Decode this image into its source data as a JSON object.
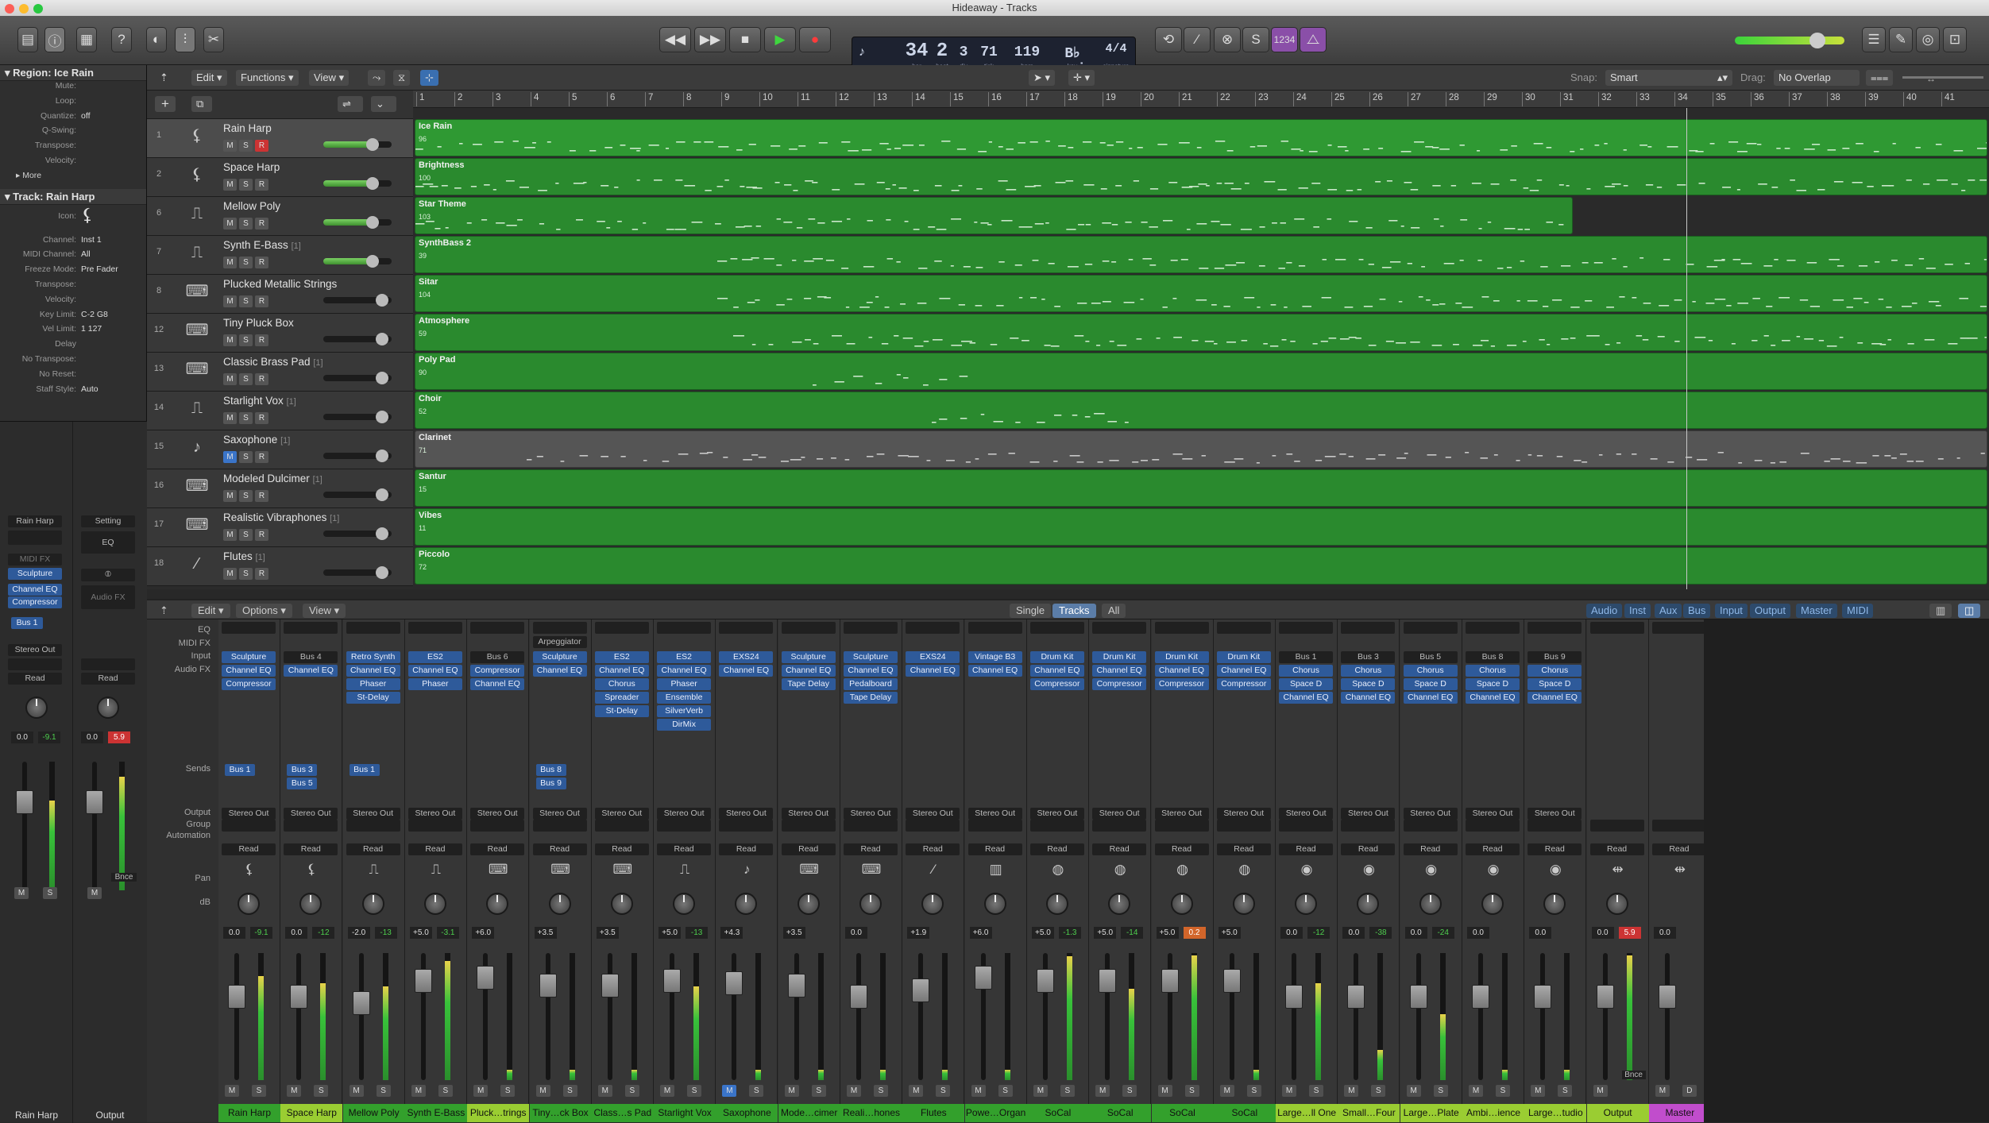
{
  "window": {
    "title": "Hideaway - Tracks"
  },
  "transport": {
    "bar": "34",
    "beat": "2",
    "div": "3",
    "tick": "71",
    "bpm": "119",
    "key": "B♭ maj",
    "sig": "4/4",
    "bar_l": "bar",
    "beat_l": "beat",
    "div_l": "div",
    "tick_l": "tick",
    "bpm_l": "bpm",
    "key_l": "key",
    "sig_l": "signature",
    "cycle_counter": "1234"
  },
  "inspector": {
    "region_title": "Region: Ice Rain",
    "region_rows": [
      [
        "Mute:",
        ""
      ],
      [
        "Loop:",
        ""
      ],
      [
        "Quantize:",
        "off"
      ],
      [
        "Q-Swing:",
        ""
      ],
      [
        "Transpose:",
        ""
      ],
      [
        "Velocity:",
        ""
      ]
    ],
    "more": "More",
    "track_title": "Track:  Rain Harp",
    "icon_label": "Icon:",
    "track_rows": [
      [
        "Channel:",
        "Inst 1"
      ],
      [
        "MIDI Channel:",
        "All"
      ],
      [
        "Freeze Mode:",
        "Pre Fader"
      ],
      [
        "Transpose:",
        ""
      ],
      [
        "Velocity:",
        ""
      ],
      [
        "Key Limit:",
        "C-2     G8"
      ],
      [
        "Vel Limit:",
        "1     127"
      ],
      [
        "Delay",
        ""
      ],
      [
        "No Transpose:",
        ""
      ],
      [
        "No Reset:",
        ""
      ],
      [
        "Staff Style:",
        "Auto"
      ]
    ],
    "strip1": {
      "input": "Rain Harp",
      "midi_fx": "MIDI FX",
      "instr": "Sculpture",
      "fx": [
        "Channel EQ",
        "Compressor"
      ],
      "send": "Bus 1",
      "output": "Stereo Out",
      "automation": "Read",
      "vol": "0.0",
      "peak": "-9.1",
      "name": "Rain Harp"
    },
    "strip2": {
      "setting": "Setting",
      "eq": "EQ",
      "audiofx": "Audio FX",
      "automation": "Read",
      "vol": "0.0",
      "peak": "5.9",
      "bnce": "Bnce",
      "name": "Output"
    }
  },
  "tracks_area": {
    "menus": [
      "Edit",
      "Functions",
      "View"
    ],
    "snap_label": "Snap:",
    "snap_value": "Smart",
    "drag_label": "Drag:",
    "drag_value": "No Overlap",
    "bars": [
      "1",
      "2",
      "3",
      "4",
      "5",
      "6",
      "7",
      "8",
      "9",
      "10",
      "11",
      "12",
      "13",
      "14",
      "15",
      "16",
      "17",
      "18",
      "19",
      "20",
      "21",
      "22",
      "23",
      "24",
      "25",
      "26",
      "27",
      "28",
      "29",
      "30",
      "31",
      "32",
      "33",
      "34",
      "35",
      "36",
      "37",
      "38",
      "39",
      "40",
      "41"
    ]
  },
  "tracks": [
    {
      "num": "1",
      "name": "Rain Harp",
      "sub": "",
      "icon": "harp-icon",
      "region": "Ice Rain",
      "val": "96"
    },
    {
      "num": "2",
      "name": "Space Harp",
      "sub": "",
      "icon": "harp-icon",
      "region": "Brightness",
      "val": "100"
    },
    {
      "num": "6",
      "name": "Mellow Poly",
      "sub": "",
      "icon": "synth-icon",
      "region": "Star Theme",
      "val": "103"
    },
    {
      "num": "7",
      "name": "Synth E-Bass",
      "sub": "[1]",
      "icon": "synth-icon",
      "region": "SynthBass 2",
      "val": "39"
    },
    {
      "num": "8",
      "name": "Plucked Metallic Strings",
      "sub": "",
      "icon": "keyboard-icon",
      "region": "Sitar",
      "val": "104"
    },
    {
      "num": "12",
      "name": "Tiny Pluck Box",
      "sub": "",
      "icon": "keyboard-icon",
      "region": "Atmosphere",
      "val": "59"
    },
    {
      "num": "13",
      "name": "Classic Brass Pad",
      "sub": "[1]",
      "icon": "keyboard-icon",
      "region": "Poly Pad",
      "val": "90"
    },
    {
      "num": "14",
      "name": "Starlight Vox",
      "sub": "[1]",
      "icon": "synth-icon",
      "region": "Choir",
      "val": "52"
    },
    {
      "num": "15",
      "name": "Saxophone",
      "sub": "[1]",
      "icon": "saxophone-icon",
      "region": "Clarinet",
      "val": "71"
    },
    {
      "num": "16",
      "name": "Modeled Dulcimer",
      "sub": "[1]",
      "icon": "keyboard-icon",
      "region": "Santur",
      "val": "15"
    },
    {
      "num": "17",
      "name": "Realistic Vibraphones",
      "sub": "[1]",
      "icon": "keyboard-icon",
      "region": "Vibes",
      "val": "11"
    },
    {
      "num": "18",
      "name": "Flutes",
      "sub": "[1]",
      "icon": "flute-icon",
      "region": "Piccolo",
      "val": "72"
    }
  ],
  "mixer": {
    "menus": [
      "Edit",
      "Options",
      "View"
    ],
    "views": [
      "Single",
      "Tracks",
      "All"
    ],
    "filters": [
      "Audio",
      "Inst",
      "Aux",
      "Bus",
      "Input",
      "Output",
      "Master",
      "MIDI"
    ],
    "row_labels": [
      "EQ",
      "MIDI FX",
      "Input",
      "Audio FX",
      "Sends",
      "Output",
      "Group",
      "Automation",
      "Pan",
      "dB"
    ],
    "read": "Read",
    "stereo_out": "Stereo Out",
    "arpeggiator": "Arpeggiator",
    "bnce": "Bnce",
    "strips": [
      {
        "input": "Sculpture",
        "fx": [
          "Channel EQ",
          "Compressor"
        ],
        "sends": [
          "Bus 1"
        ],
        "vol": "0.0",
        "peak": "-9.1",
        "name": "Rain Harp",
        "color": "#33a02c"
      },
      {
        "input": "Bus 4",
        "fx": [
          "Channel EQ"
        ],
        "sends": [
          "Bus 3",
          "Bus 5"
        ],
        "vol": "0.0",
        "peak": "-12",
        "name": "Space Harp",
        "color": "#9acd32"
      },
      {
        "input": "Retro Synth",
        "fx": [
          "Channel EQ",
          "Phaser",
          "St-Delay"
        ],
        "sends": [
          "Bus 1"
        ],
        "vol": "-2.0",
        "peak": "-13",
        "name": "Mellow Poly",
        "color": "#33a02c"
      },
      {
        "input": "ES2",
        "fx": [
          "Channel EQ",
          "Phaser"
        ],
        "sends": [],
        "vol": "+5.0",
        "peak": "-3.1",
        "name": "Synth E-Bass",
        "color": "#33a02c"
      },
      {
        "input": "Bus 6",
        "fx": [
          "Compressor",
          "Channel EQ"
        ],
        "sends": [],
        "vol": "+6.0",
        "peak": "",
        "name": "Pluck…trings",
        "color": "#9acd32"
      },
      {
        "input": "Sculpture",
        "fx": [
          "Channel EQ"
        ],
        "sends": [
          "Bus 8",
          "Bus 9"
        ],
        "vol": "+3.5",
        "peak": "",
        "name": "Tiny…ck Box",
        "color": "#33a02c"
      },
      {
        "input": "ES2",
        "fx": [
          "Channel EQ",
          "Chorus",
          "Spreader",
          "St-Delay"
        ],
        "sends": [],
        "vol": "+3.5",
        "peak": "",
        "name": "Class…s Pad",
        "color": "#33a02c"
      },
      {
        "input": "ES2",
        "fx": [
          "Channel EQ",
          "Phaser",
          "Ensemble",
          "SilverVerb",
          "DirMix"
        ],
        "sends": [],
        "vol": "+5.0",
        "peak": "-13",
        "name": "Starlight Vox",
        "color": "#33a02c"
      },
      {
        "input": "EXS24",
        "fx": [
          "Channel EQ"
        ],
        "sends": [],
        "vol": "+4.3",
        "peak": "",
        "name": "Saxophone",
        "color": "#33a02c"
      },
      {
        "input": "Sculpture",
        "fx": [
          "Channel EQ",
          "Tape Delay"
        ],
        "sends": [],
        "vol": "+3.5",
        "peak": "",
        "name": "Mode…cimer",
        "color": "#33a02c"
      },
      {
        "input": "Sculpture",
        "fx": [
          "Channel EQ",
          "Pedalboard",
          "Tape Delay"
        ],
        "sends": [],
        "vol": "0.0",
        "peak": "",
        "name": "Reali…hones",
        "color": "#33a02c"
      },
      {
        "input": "EXS24",
        "fx": [
          "Channel EQ"
        ],
        "sends": [],
        "vol": "+1.9",
        "peak": "",
        "name": "Flutes",
        "color": "#33a02c"
      },
      {
        "input": "Vintage B3",
        "fx": [
          "Channel EQ"
        ],
        "sends": [],
        "vol": "+6.0",
        "peak": "",
        "name": "Powe…Organ",
        "color": "#33a02c"
      },
      {
        "input": "Drum Kit",
        "fx": [
          "Channel EQ",
          "Compressor"
        ],
        "sends": [],
        "vol": "+5.0",
        "peak": "-1.3",
        "name": "SoCal",
        "color": "#33a02c"
      },
      {
        "input": "Drum Kit",
        "fx": [
          "Channel EQ",
          "Compressor"
        ],
        "sends": [],
        "vol": "+5.0",
        "peak": "-14",
        "name": "SoCal",
        "color": "#33a02c"
      },
      {
        "input": "Drum Kit",
        "fx": [
          "Channel EQ",
          "Compressor"
        ],
        "sends": [],
        "vol": "+5.0",
        "peak": "0.2",
        "name": "SoCal",
        "color": "#33a02c"
      },
      {
        "input": "Drum Kit",
        "fx": [
          "Channel EQ",
          "Compressor"
        ],
        "sends": [],
        "vol": "+5.0",
        "peak": "",
        "name": "SoCal",
        "color": "#33a02c"
      },
      {
        "input": "Bus 1",
        "fx": [
          "Chorus",
          "Space D",
          "Channel EQ"
        ],
        "sends": [],
        "vol": "0.0",
        "peak": "-12",
        "name": "Large…ll One",
        "color": "#9acd32"
      },
      {
        "input": "Bus 3",
        "fx": [
          "Chorus",
          "Space D",
          "Channel EQ"
        ],
        "sends": [],
        "vol": "0.0",
        "peak": "-38",
        "name": "Small…Four",
        "color": "#9acd32"
      },
      {
        "input": "Bus 5",
        "fx": [
          "Chorus",
          "Space D",
          "Channel EQ"
        ],
        "sends": [],
        "vol": "0.0",
        "peak": "-24",
        "name": "Large…Plate",
        "color": "#9acd32"
      },
      {
        "input": "Bus 8",
        "fx": [
          "Chorus",
          "Space D",
          "Channel EQ"
        ],
        "sends": [],
        "vol": "0.0",
        "peak": "",
        "name": "Ambi…ience",
        "color": "#9acd32"
      },
      {
        "input": "Bus 9",
        "fx": [
          "Chorus",
          "Space D",
          "Channel EQ"
        ],
        "sends": [],
        "vol": "0.0",
        "peak": "",
        "name": "Large…tudio",
        "color": "#9acd32"
      },
      {
        "input": "",
        "fx": [],
        "sends": [],
        "vol": "0.0",
        "peak": "5.9",
        "name": "Output",
        "color": "#9acd32"
      },
      {
        "input": "",
        "fx": [],
        "sends": [],
        "vol": "0.0",
        "peak": "",
        "name": "Master",
        "color": "#c14dcc"
      }
    ]
  }
}
